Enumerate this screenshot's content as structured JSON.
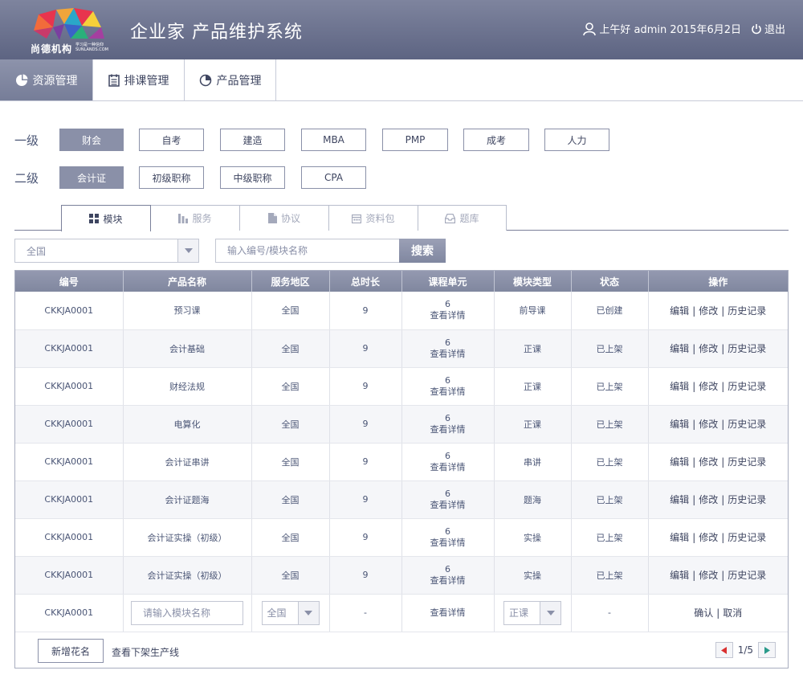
{
  "header": {
    "logo_text": "尚德机构",
    "logo_slogan": "学习是一种信仰",
    "logo_en": "SUNLANDS.COM",
    "title": "企业家 产品维护系统",
    "greeting": "上午好 admin 2015年6月2日",
    "logout_label": "退出"
  },
  "nav": {
    "items": [
      {
        "label": "资源管理",
        "icon": "pie-chart-icon",
        "active": true
      },
      {
        "label": "排课管理",
        "icon": "list-icon",
        "active": false
      },
      {
        "label": "产品管理",
        "icon": "pie-chart-icon",
        "active": false
      }
    ]
  },
  "filters": {
    "level1_label": "一级",
    "level1": [
      "财会",
      "自考",
      "建造",
      "MBA",
      "PMP",
      "成考",
      "人力"
    ],
    "level1_active": "财会",
    "level2_label": "二级",
    "level2": [
      "会计证",
      "初级职称",
      "中级职称",
      "CPA"
    ],
    "level2_active": "会计证"
  },
  "tabs": [
    {
      "label": "模块",
      "icon": "grid-icon",
      "active": true
    },
    {
      "label": "服务",
      "icon": "bar-icon",
      "active": false
    },
    {
      "label": "协议",
      "icon": "document-icon",
      "active": false
    },
    {
      "label": "资料包",
      "icon": "calendar-icon",
      "active": false
    },
    {
      "label": "题库",
      "icon": "tray-icon",
      "active": false
    }
  ],
  "search": {
    "region_value": "全国",
    "placeholder": "输入编号/模块名称",
    "button_label": "搜索"
  },
  "table": {
    "columns": [
      "编号",
      "产品名称",
      "服务地区",
      "总时长",
      "课程单元",
      "模块类型",
      "状态",
      "操作"
    ],
    "unit_link": "查看详情",
    "ops": [
      "编辑",
      "修改",
      "历史记录"
    ],
    "rows": [
      {
        "id": "CKKJA0001",
        "name": "预习课",
        "region": "全国",
        "duration": "9",
        "units": "6",
        "type": "前导课",
        "status": "已创建"
      },
      {
        "id": "CKKJA0001",
        "name": "会计基础",
        "region": "全国",
        "duration": "9",
        "units": "6",
        "type": "正课",
        "status": "已上架"
      },
      {
        "id": "CKKJA0001",
        "name": "财经法规",
        "region": "全国",
        "duration": "9",
        "units": "6",
        "type": "正课",
        "status": "已上架"
      },
      {
        "id": "CKKJA0001",
        "name": "电算化",
        "region": "全国",
        "duration": "9",
        "units": "6",
        "type": "正课",
        "status": "已上架"
      },
      {
        "id": "CKKJA0001",
        "name": "会计证串讲",
        "region": "全国",
        "duration": "9",
        "units": "6",
        "type": "串讲",
        "status": "已上架"
      },
      {
        "id": "CKKJA0001",
        "name": "会计证题海",
        "region": "全国",
        "duration": "9",
        "units": "6",
        "type": "题海",
        "status": "已上架"
      },
      {
        "id": "CKKJA0001",
        "name": "会计证实操（初级）",
        "region": "全国",
        "duration": "9",
        "units": "6",
        "type": "实操",
        "status": "已上架"
      },
      {
        "id": "CKKJA0001",
        "name": "会计证实操（初级）",
        "region": "全国",
        "duration": "9",
        "units": "6",
        "type": "实操",
        "status": "已上架"
      }
    ],
    "edit_row": {
      "id": "CKKJA0001",
      "name_placeholder": "请输入模块名称",
      "region_value": "全国",
      "duration": "-",
      "unit_link": "查看详情",
      "type_value": "正课",
      "status": "-",
      "confirm": "确认",
      "cancel": "取消"
    }
  },
  "footer": {
    "add_label": "新增花名",
    "line_link": "查看下架生产线",
    "page": "1/5"
  },
  "colors": {
    "header": "#6b718e",
    "accent": "#8a90a8",
    "prev_arrow": "#d9302f",
    "next_arrow": "#2a9a8a"
  }
}
